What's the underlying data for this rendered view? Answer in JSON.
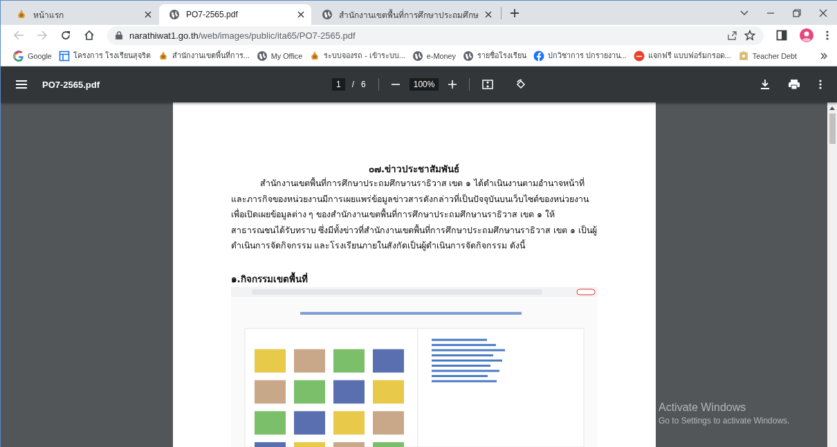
{
  "tabs": [
    {
      "title": "หน้าแรก",
      "selected": false
    },
    {
      "title": "PO7-2565.pdf",
      "selected": true
    },
    {
      "title": "สำนักงานเขตพื้นที่การศึกษาประถมศึกษ",
      "selected": false
    }
  ],
  "address_bar": {
    "domain": "narathiwat1.go.th",
    "path": "/web/images/public/ita65/PO7-2565.pdf"
  },
  "bookmarks": [
    {
      "label": "Google"
    },
    {
      "label": "โครงการ โรงเรียนสุจริต"
    },
    {
      "label": "สำนักงานเขตพื้นที่การ..."
    },
    {
      "label": "My Office"
    },
    {
      "label": "ระบบจองรถ - เข้าระบบ..."
    },
    {
      "label": "e-Money"
    },
    {
      "label": "รายชื่อโรงเรียน"
    },
    {
      "label": "ปกวิชาการ ปกรายงาน..."
    },
    {
      "label": "แจกฟรี แบบฟอร์มกรอด..."
    },
    {
      "label": "Teacher Debt"
    }
  ],
  "pdf_toolbar": {
    "file_name": "PO7-2565.pdf",
    "page": "1",
    "page_separator": "/",
    "page_count": "6",
    "zoom": "100%"
  },
  "document": {
    "heading": "๐๗.ข่าวประชาสัมพันธ์",
    "paragraph": "สำนักงานเขตพื้นที่การศึกษาประถมศึกษานราธิวาส เขต ๑ ได้ดำเนินงานตามอำนาจหน้าที่และภารกิจของหน่วยงานมีการเผยแพร่ข้อมูลข่าวสารดังกล่าวที่เป็นปัจจุบันบนเว็บไซต์ของหน่วยงานเพื่อเปิดเผยข้อมูลต่าง ๆ ของสำนักงานเขตพื้นที่การศึกษาประถมศึกษานราธิวาส เขต ๑ ให้สาธารณชนได้รับทราบ ซึ่งมีทั้งข่าวที่สำนักงานเขตพื้นที่การศึกษาประถมศึกษานราธิวาส เขต ๑ เป็นผู้ดำเนินการจัดกิจกรรม และโรงเรียนภายในสังกัดเป็นผู้ดำเนินการจัดกิจกรรม ดังนี้",
    "section_heading": "๑.กิจกรรมเขตพื้นที่"
  },
  "os_notice": {
    "title": "Activate Windows",
    "subtitle": "Go to Settings to activate Windows."
  }
}
